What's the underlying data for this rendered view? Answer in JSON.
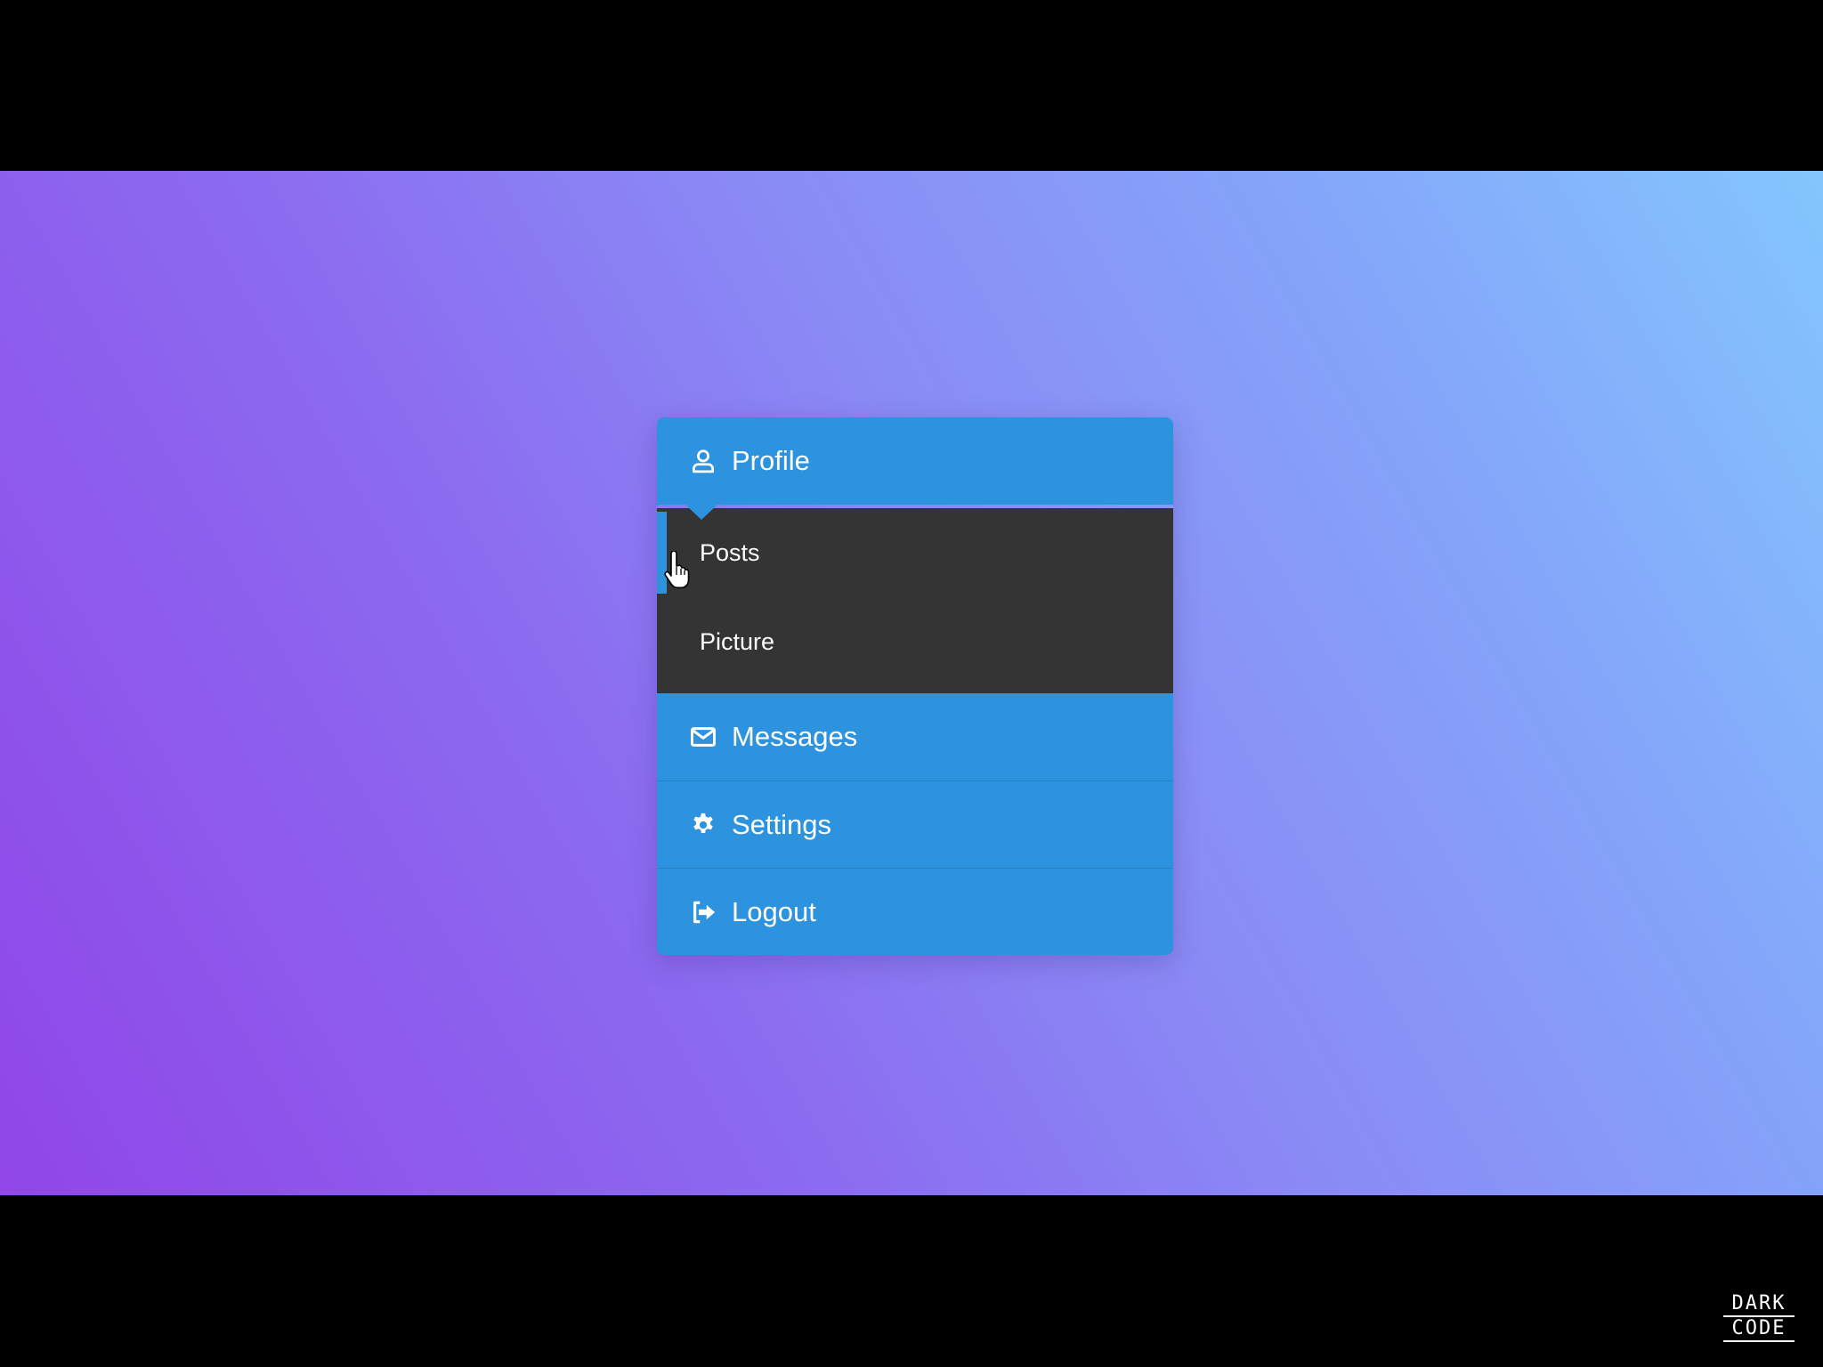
{
  "menu": {
    "profile": {
      "label": "Profile",
      "icon": "user-icon"
    },
    "submenu": [
      {
        "label": "Posts",
        "active": true
      },
      {
        "label": "Picture",
        "active": false
      }
    ],
    "messages": {
      "label": "Messages",
      "icon": "envelope-icon"
    },
    "settings": {
      "label": "Settings",
      "icon": "gear-icon"
    },
    "logout": {
      "label": "Logout",
      "icon": "sign-out-icon"
    }
  },
  "brand": {
    "line1": "DARK",
    "line2": "CODE"
  },
  "colors": {
    "menu_blue": "#2d93de",
    "submenu_dark": "#343434",
    "gradient_start": "#9046e8",
    "gradient_end": "#83c6fd"
  }
}
